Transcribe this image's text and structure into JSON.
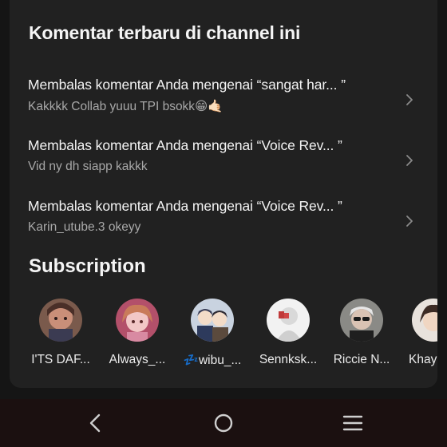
{
  "comments_section": {
    "title": "Komentar terbaru di channel ini",
    "items": [
      {
        "title": "Membalas komentar Anda mengenai “sangat har... ”",
        "reply": "Kakkkk Collab yuuu TPI bsokk😁🤙🏻"
      },
      {
        "title": "Membalas komentar Anda mengenai “Voice Rev... ”",
        "reply": "Vid ny dh siapp kakkk"
      },
      {
        "title": "Membalas komentar Anda mengenai “Voice Rev... ”",
        "reply": "Karin_utube.3 okeyy"
      }
    ]
  },
  "subscription_section": {
    "title": "Subscription",
    "channels": [
      {
        "name": "I'TS DAF..."
      },
      {
        "name": "Always_..."
      },
      {
        "name": "💤wibu_..."
      },
      {
        "name": "Sennksk..."
      },
      {
        "name": "Riccie N..."
      },
      {
        "name": "Khay"
      }
    ]
  },
  "icons": {
    "chevron": "chevron-right-icon",
    "back": "back-icon",
    "home": "home-icon",
    "recents": "recents-icon"
  },
  "colors": {
    "sheet_background": "#212121",
    "backdrop": "#151515",
    "nav_bar": "#1b1010",
    "secondary_text": "#a8a8a8"
  }
}
